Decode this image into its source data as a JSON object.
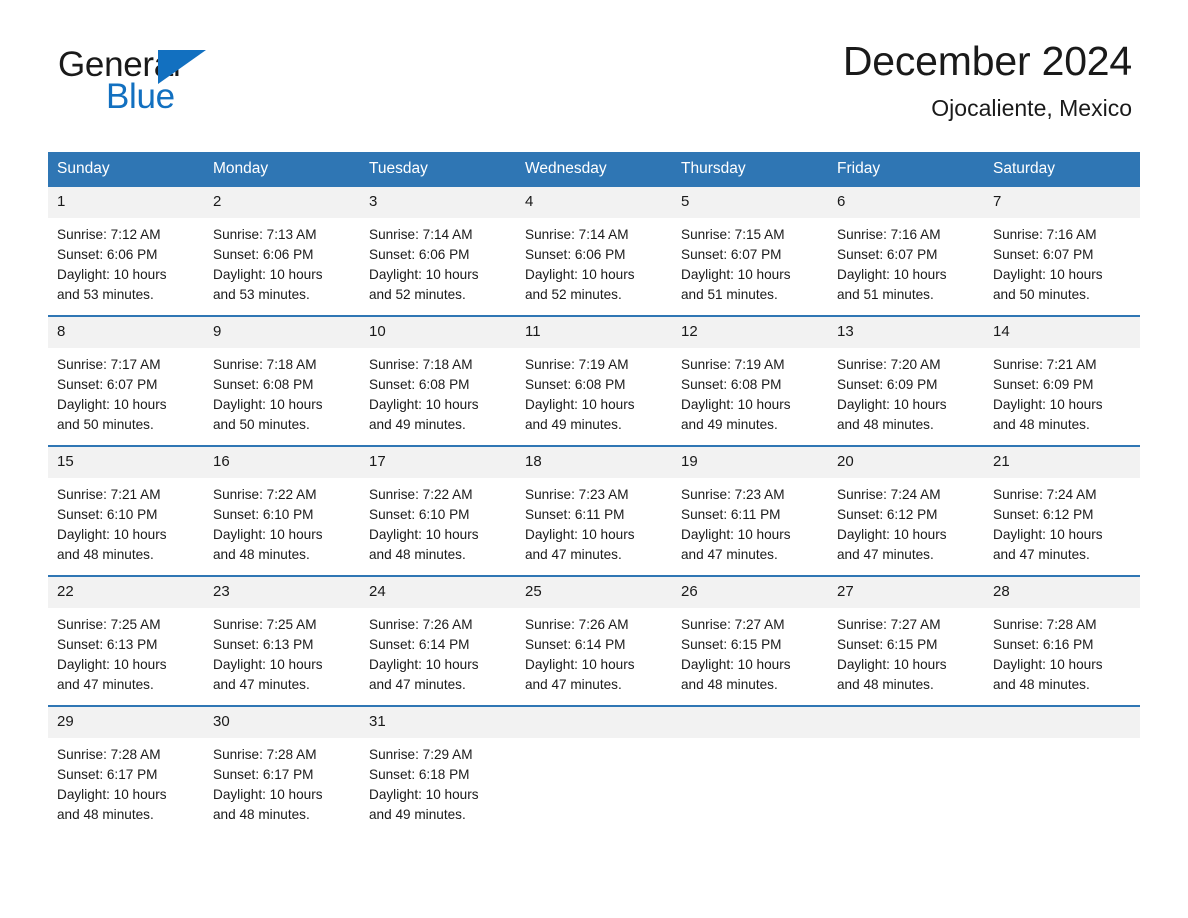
{
  "brand": {
    "word_one": "General",
    "word_two": "Blue",
    "triangle_color": "#1270c0",
    "icon": "triangle-logo"
  },
  "header": {
    "title": "December 2024",
    "subtitle": "Ojocaliente, Mexico"
  },
  "theme": {
    "header_blue": "#2f76b4",
    "daynum_gray": "#f2f2f2",
    "text": "#1a1a1a",
    "brand_blue": "#1270c0"
  },
  "weekday_headers": [
    "Sunday",
    "Monday",
    "Tuesday",
    "Wednesday",
    "Thursday",
    "Friday",
    "Saturday"
  ],
  "weeks": [
    [
      {
        "day": "1",
        "sunrise": "Sunrise: 7:12 AM",
        "sunset": "Sunset: 6:06 PM",
        "daylight_1": "Daylight: 10 hours",
        "daylight_2": "and 53 minutes."
      },
      {
        "day": "2",
        "sunrise": "Sunrise: 7:13 AM",
        "sunset": "Sunset: 6:06 PM",
        "daylight_1": "Daylight: 10 hours",
        "daylight_2": "and 53 minutes."
      },
      {
        "day": "3",
        "sunrise": "Sunrise: 7:14 AM",
        "sunset": "Sunset: 6:06 PM",
        "daylight_1": "Daylight: 10 hours",
        "daylight_2": "and 52 minutes."
      },
      {
        "day": "4",
        "sunrise": "Sunrise: 7:14 AM",
        "sunset": "Sunset: 6:06 PM",
        "daylight_1": "Daylight: 10 hours",
        "daylight_2": "and 52 minutes."
      },
      {
        "day": "5",
        "sunrise": "Sunrise: 7:15 AM",
        "sunset": "Sunset: 6:07 PM",
        "daylight_1": "Daylight: 10 hours",
        "daylight_2": "and 51 minutes."
      },
      {
        "day": "6",
        "sunrise": "Sunrise: 7:16 AM",
        "sunset": "Sunset: 6:07 PM",
        "daylight_1": "Daylight: 10 hours",
        "daylight_2": "and 51 minutes."
      },
      {
        "day": "7",
        "sunrise": "Sunrise: 7:16 AM",
        "sunset": "Sunset: 6:07 PM",
        "daylight_1": "Daylight: 10 hours",
        "daylight_2": "and 50 minutes."
      }
    ],
    [
      {
        "day": "8",
        "sunrise": "Sunrise: 7:17 AM",
        "sunset": "Sunset: 6:07 PM",
        "daylight_1": "Daylight: 10 hours",
        "daylight_2": "and 50 minutes."
      },
      {
        "day": "9",
        "sunrise": "Sunrise: 7:18 AM",
        "sunset": "Sunset: 6:08 PM",
        "daylight_1": "Daylight: 10 hours",
        "daylight_2": "and 50 minutes."
      },
      {
        "day": "10",
        "sunrise": "Sunrise: 7:18 AM",
        "sunset": "Sunset: 6:08 PM",
        "daylight_1": "Daylight: 10 hours",
        "daylight_2": "and 49 minutes."
      },
      {
        "day": "11",
        "sunrise": "Sunrise: 7:19 AM",
        "sunset": "Sunset: 6:08 PM",
        "daylight_1": "Daylight: 10 hours",
        "daylight_2": "and 49 minutes."
      },
      {
        "day": "12",
        "sunrise": "Sunrise: 7:19 AM",
        "sunset": "Sunset: 6:08 PM",
        "daylight_1": "Daylight: 10 hours",
        "daylight_2": "and 49 minutes."
      },
      {
        "day": "13",
        "sunrise": "Sunrise: 7:20 AM",
        "sunset": "Sunset: 6:09 PM",
        "daylight_1": "Daylight: 10 hours",
        "daylight_2": "and 48 minutes."
      },
      {
        "day": "14",
        "sunrise": "Sunrise: 7:21 AM",
        "sunset": "Sunset: 6:09 PM",
        "daylight_1": "Daylight: 10 hours",
        "daylight_2": "and 48 minutes."
      }
    ],
    [
      {
        "day": "15",
        "sunrise": "Sunrise: 7:21 AM",
        "sunset": "Sunset: 6:10 PM",
        "daylight_1": "Daylight: 10 hours",
        "daylight_2": "and 48 minutes."
      },
      {
        "day": "16",
        "sunrise": "Sunrise: 7:22 AM",
        "sunset": "Sunset: 6:10 PM",
        "daylight_1": "Daylight: 10 hours",
        "daylight_2": "and 48 minutes."
      },
      {
        "day": "17",
        "sunrise": "Sunrise: 7:22 AM",
        "sunset": "Sunset: 6:10 PM",
        "daylight_1": "Daylight: 10 hours",
        "daylight_2": "and 48 minutes."
      },
      {
        "day": "18",
        "sunrise": "Sunrise: 7:23 AM",
        "sunset": "Sunset: 6:11 PM",
        "daylight_1": "Daylight: 10 hours",
        "daylight_2": "and 47 minutes."
      },
      {
        "day": "19",
        "sunrise": "Sunrise: 7:23 AM",
        "sunset": "Sunset: 6:11 PM",
        "daylight_1": "Daylight: 10 hours",
        "daylight_2": "and 47 minutes."
      },
      {
        "day": "20",
        "sunrise": "Sunrise: 7:24 AM",
        "sunset": "Sunset: 6:12 PM",
        "daylight_1": "Daylight: 10 hours",
        "daylight_2": "and 47 minutes."
      },
      {
        "day": "21",
        "sunrise": "Sunrise: 7:24 AM",
        "sunset": "Sunset: 6:12 PM",
        "daylight_1": "Daylight: 10 hours",
        "daylight_2": "and 47 minutes."
      }
    ],
    [
      {
        "day": "22",
        "sunrise": "Sunrise: 7:25 AM",
        "sunset": "Sunset: 6:13 PM",
        "daylight_1": "Daylight: 10 hours",
        "daylight_2": "and 47 minutes."
      },
      {
        "day": "23",
        "sunrise": "Sunrise: 7:25 AM",
        "sunset": "Sunset: 6:13 PM",
        "daylight_1": "Daylight: 10 hours",
        "daylight_2": "and 47 minutes."
      },
      {
        "day": "24",
        "sunrise": "Sunrise: 7:26 AM",
        "sunset": "Sunset: 6:14 PM",
        "daylight_1": "Daylight: 10 hours",
        "daylight_2": "and 47 minutes."
      },
      {
        "day": "25",
        "sunrise": "Sunrise: 7:26 AM",
        "sunset": "Sunset: 6:14 PM",
        "daylight_1": "Daylight: 10 hours",
        "daylight_2": "and 47 minutes."
      },
      {
        "day": "26",
        "sunrise": "Sunrise: 7:27 AM",
        "sunset": "Sunset: 6:15 PM",
        "daylight_1": "Daylight: 10 hours",
        "daylight_2": "and 48 minutes."
      },
      {
        "day": "27",
        "sunrise": "Sunrise: 7:27 AM",
        "sunset": "Sunset: 6:15 PM",
        "daylight_1": "Daylight: 10 hours",
        "daylight_2": "and 48 minutes."
      },
      {
        "day": "28",
        "sunrise": "Sunrise: 7:28 AM",
        "sunset": "Sunset: 6:16 PM",
        "daylight_1": "Daylight: 10 hours",
        "daylight_2": "and 48 minutes."
      }
    ],
    [
      {
        "day": "29",
        "sunrise": "Sunrise: 7:28 AM",
        "sunset": "Sunset: 6:17 PM",
        "daylight_1": "Daylight: 10 hours",
        "daylight_2": "and 48 minutes."
      },
      {
        "day": "30",
        "sunrise": "Sunrise: 7:28 AM",
        "sunset": "Sunset: 6:17 PM",
        "daylight_1": "Daylight: 10 hours",
        "daylight_2": "and 48 minutes."
      },
      {
        "day": "31",
        "sunrise": "Sunrise: 7:29 AM",
        "sunset": "Sunset: 6:18 PM",
        "daylight_1": "Daylight: 10 hours",
        "daylight_2": "and 49 minutes."
      },
      {
        "day": "",
        "sunrise": "",
        "sunset": "",
        "daylight_1": "",
        "daylight_2": "",
        "blank": true
      },
      {
        "day": "",
        "sunrise": "",
        "sunset": "",
        "daylight_1": "",
        "daylight_2": "",
        "blank": true
      },
      {
        "day": "",
        "sunrise": "",
        "sunset": "",
        "daylight_1": "",
        "daylight_2": "",
        "blank": true
      },
      {
        "day": "",
        "sunrise": "",
        "sunset": "",
        "daylight_1": "",
        "daylight_2": "",
        "blank": true
      }
    ]
  ]
}
